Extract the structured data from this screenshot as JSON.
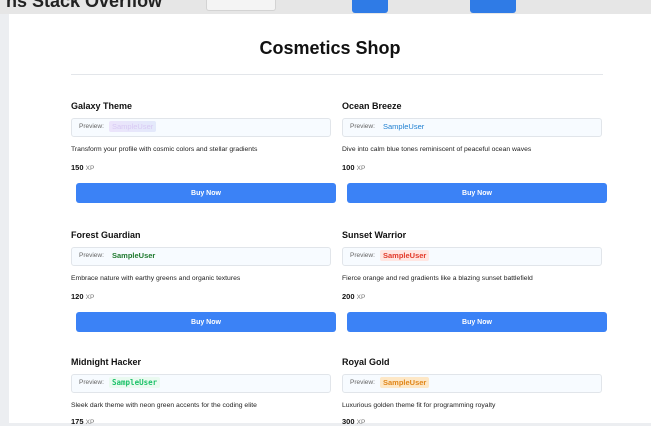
{
  "header": {
    "clipped_title": "ns Stack Overflow"
  },
  "page": {
    "title": "Cosmetics Shop"
  },
  "preview_label": "Preview:",
  "buy_label": "Buy Now",
  "currency": "XP",
  "items": [
    {
      "name": "Galaxy Theme",
      "preview_user": "SampleUser",
      "description": "Transform your profile with cosmic colors and stellar gradients",
      "price": "150"
    },
    {
      "name": "Ocean Breeze",
      "preview_user": "SampleUser",
      "description": "Dive into calm blue tones reminiscent of peaceful ocean waves",
      "price": "100"
    },
    {
      "name": "Forest Guardian",
      "preview_user": "SampleUser",
      "description": "Embrace nature with earthy greens and organic textures",
      "price": "120"
    },
    {
      "name": "Sunset Warrior",
      "preview_user": "SampleUser",
      "description": "Fierce orange and red gradients like a blazing sunset battlefield",
      "price": "200"
    },
    {
      "name": "Midnight Hacker",
      "preview_user": "SampleUser",
      "description": "Sleek dark theme with neon green accents for the coding elite",
      "price": "175"
    },
    {
      "name": "Royal Gold",
      "preview_user": "SampleUser",
      "description": "Luxurious golden theme fit for programming royalty",
      "price": "300"
    }
  ],
  "colors": {
    "accent": "#3b82f6",
    "background": "#ffffff"
  }
}
